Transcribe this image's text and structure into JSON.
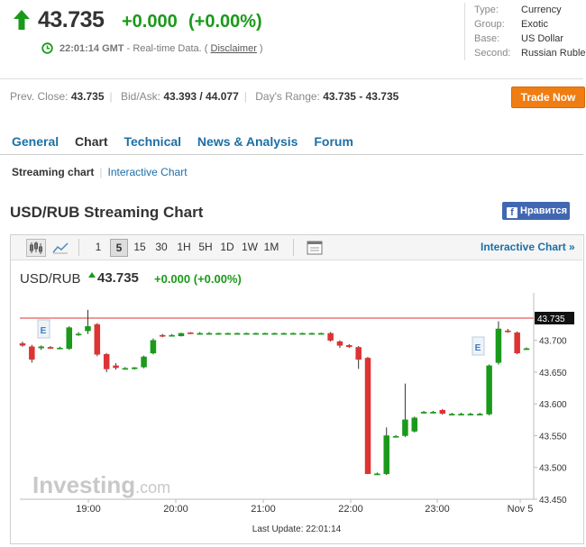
{
  "quote": {
    "price": "43.735",
    "change": "+0.000",
    "change_pct": "(+0.00%)",
    "time": "22:01:14 GMT",
    "realtime_label": "- Real-time Data. (",
    "disclaimer": "Disclaimer",
    "close_paren": ")"
  },
  "info": [
    {
      "key": "Type:",
      "value": "Currency"
    },
    {
      "key": "Group:",
      "value": "Exotic"
    },
    {
      "key": "Base:",
      "value": "US Dollar"
    },
    {
      "key": "Second:",
      "value": "Russian Ruble"
    }
  ],
  "stats": {
    "prev_close_label": "Prev. Close:",
    "prev_close": "43.735",
    "bidask_label": "Bid/Ask:",
    "bidask": "43.393 / 44.077",
    "range_label": "Day's Range:",
    "range": "43.735 - 43.735"
  },
  "trade_button": "Trade Now",
  "tabs": [
    "General",
    "Chart",
    "Technical",
    "News & Analysis",
    "Forum"
  ],
  "active_tab": "Chart",
  "subtabs": {
    "streaming": "Streaming chart",
    "interactive": "Interactive Chart"
  },
  "chart_heading": "USD/RUB Streaming Chart",
  "fb_like": "Нравится",
  "fb_letter": "f",
  "toolbar": {
    "timeframes": [
      "1",
      "5",
      "15",
      "30",
      "1H",
      "5H",
      "1D",
      "1W",
      "1M"
    ],
    "selected": "5",
    "interactive_link": "Interactive Chart »"
  },
  "symbol": "USD/RUB",
  "symbol_price": "43.735",
  "symbol_change": "+0.000 (+0.00%)",
  "colors": {
    "up": "#1a9a1a",
    "down": "#d33",
    "link": "#1d6fa5",
    "accent": "#f07d12"
  },
  "chart_data": {
    "type": "candlestick",
    "x_ticks": [
      "19:00",
      "20:00",
      "21:00",
      "22:00",
      "23:00",
      "Nov 5"
    ],
    "y_ticks": [
      43.7,
      43.65,
      43.6,
      43.55,
      43.5,
      43.45
    ],
    "ylim": [
      43.45,
      43.735
    ],
    "current_price_label": "43.735",
    "watermark": "Investing.com",
    "event_marker": "E",
    "last_update": "Last Update: 22:01:14",
    "candles": [
      {
        "o": 43.695,
        "h": 43.698,
        "l": 43.69,
        "c": 43.692
      },
      {
        "o": 43.69,
        "h": 43.693,
        "l": 43.665,
        "c": 43.67
      },
      {
        "o": 43.688,
        "h": 43.692,
        "l": 43.685,
        "c": 43.69
      },
      {
        "o": 43.689,
        "h": 43.691,
        "l": 43.687,
        "c": 43.688
      },
      {
        "o": 43.688,
        "h": 43.69,
        "l": 43.686,
        "c": 43.688
      },
      {
        "o": 43.687,
        "h": 43.722,
        "l": 43.685,
        "c": 43.72
      },
      {
        "o": 43.71,
        "h": 43.713,
        "l": 43.707,
        "c": 43.71
      },
      {
        "o": 43.715,
        "h": 43.748,
        "l": 43.71,
        "c": 43.722
      },
      {
        "o": 43.725,
        "h": 43.727,
        "l": 43.675,
        "c": 43.678
      },
      {
        "o": 43.678,
        "h": 43.68,
        "l": 43.65,
        "c": 43.655
      },
      {
        "o": 43.66,
        "h": 43.664,
        "l": 43.654,
        "c": 43.657
      },
      {
        "o": 43.656,
        "h": 43.658,
        "l": 43.654,
        "c": 43.656
      },
      {
        "o": 43.656,
        "h": 43.658,
        "l": 43.654,
        "c": 43.657
      },
      {
        "o": 43.658,
        "h": 43.676,
        "l": 43.656,
        "c": 43.674
      },
      {
        "o": 43.68,
        "h": 43.703,
        "l": 43.678,
        "c": 43.7
      },
      {
        "o": 43.708,
        "h": 43.71,
        "l": 43.705,
        "c": 43.707
      },
      {
        "o": 43.708,
        "h": 43.71,
        "l": 43.706,
        "c": 43.708
      },
      {
        "o": 43.707,
        "h": 43.712,
        "l": 43.706,
        "c": 43.711
      },
      {
        "o": 43.712,
        "h": 43.713,
        "l": 43.71,
        "c": 43.711
      },
      {
        "o": 43.711,
        "h": 43.713,
        "l": 43.71,
        "c": 43.711
      },
      {
        "o": 43.711,
        "h": 43.713,
        "l": 43.71,
        "c": 43.711
      },
      {
        "o": 43.711,
        "h": 43.712,
        "l": 43.71,
        "c": 43.711
      },
      {
        "o": 43.711,
        "h": 43.712,
        "l": 43.71,
        "c": 43.711
      },
      {
        "o": 43.711,
        "h": 43.712,
        "l": 43.71,
        "c": 43.711
      },
      {
        "o": 43.711,
        "h": 43.712,
        "l": 43.71,
        "c": 43.711
      },
      {
        "o": 43.711,
        "h": 43.712,
        "l": 43.71,
        "c": 43.711
      },
      {
        "o": 43.711,
        "h": 43.712,
        "l": 43.71,
        "c": 43.711
      },
      {
        "o": 43.711,
        "h": 43.712,
        "l": 43.71,
        "c": 43.711
      },
      {
        "o": 43.711,
        "h": 43.712,
        "l": 43.71,
        "c": 43.711
      },
      {
        "o": 43.711,
        "h": 43.712,
        "l": 43.71,
        "c": 43.711
      },
      {
        "o": 43.711,
        "h": 43.712,
        "l": 43.71,
        "c": 43.711
      },
      {
        "o": 43.711,
        "h": 43.712,
        "l": 43.71,
        "c": 43.711
      },
      {
        "o": 43.711,
        "h": 43.712,
        "l": 43.71,
        "c": 43.711
      },
      {
        "o": 43.711,
        "h": 43.713,
        "l": 43.698,
        "c": 43.7
      },
      {
        "o": 43.698,
        "h": 43.7,
        "l": 43.688,
        "c": 43.692
      },
      {
        "o": 43.692,
        "h": 43.694,
        "l": 43.688,
        "c": 43.69
      },
      {
        "o": 43.689,
        "h": 43.691,
        "l": 43.655,
        "c": 43.67
      },
      {
        "o": 43.672,
        "h": 43.674,
        "l": 43.49,
        "c": 43.49
      },
      {
        "o": 43.49,
        "h": 43.492,
        "l": 43.488,
        "c": 43.49
      },
      {
        "o": 43.49,
        "h": 43.563,
        "l": 43.488,
        "c": 43.55
      },
      {
        "o": 43.549,
        "h": 43.551,
        "l": 43.547,
        "c": 43.549
      },
      {
        "o": 43.55,
        "h": 43.632,
        "l": 43.548,
        "c": 43.575
      },
      {
        "o": 43.557,
        "h": 43.58,
        "l": 43.555,
        "c": 43.578
      },
      {
        "o": 43.587,
        "h": 43.589,
        "l": 43.585,
        "c": 43.587
      },
      {
        "o": 43.587,
        "h": 43.589,
        "l": 43.586,
        "c": 43.587
      },
      {
        "o": 43.59,
        "h": 43.592,
        "l": 43.583,
        "c": 43.585
      },
      {
        "o": 43.584,
        "h": 43.586,
        "l": 43.582,
        "c": 43.584
      },
      {
        "o": 43.584,
        "h": 43.586,
        "l": 43.582,
        "c": 43.584
      },
      {
        "o": 43.584,
        "h": 43.586,
        "l": 43.582,
        "c": 43.584
      },
      {
        "o": 43.584,
        "h": 43.586,
        "l": 43.582,
        "c": 43.584
      },
      {
        "o": 43.584,
        "h": 43.662,
        "l": 43.582,
        "c": 43.66
      },
      {
        "o": 43.665,
        "h": 43.73,
        "l": 43.662,
        "c": 43.718
      },
      {
        "o": 43.715,
        "h": 43.718,
        "l": 43.712,
        "c": 43.714
      },
      {
        "o": 43.712,
        "h": 43.714,
        "l": 43.678,
        "c": 43.68
      },
      {
        "o": 43.687,
        "h": 43.689,
        "l": 43.685,
        "c": 43.687
      }
    ]
  }
}
